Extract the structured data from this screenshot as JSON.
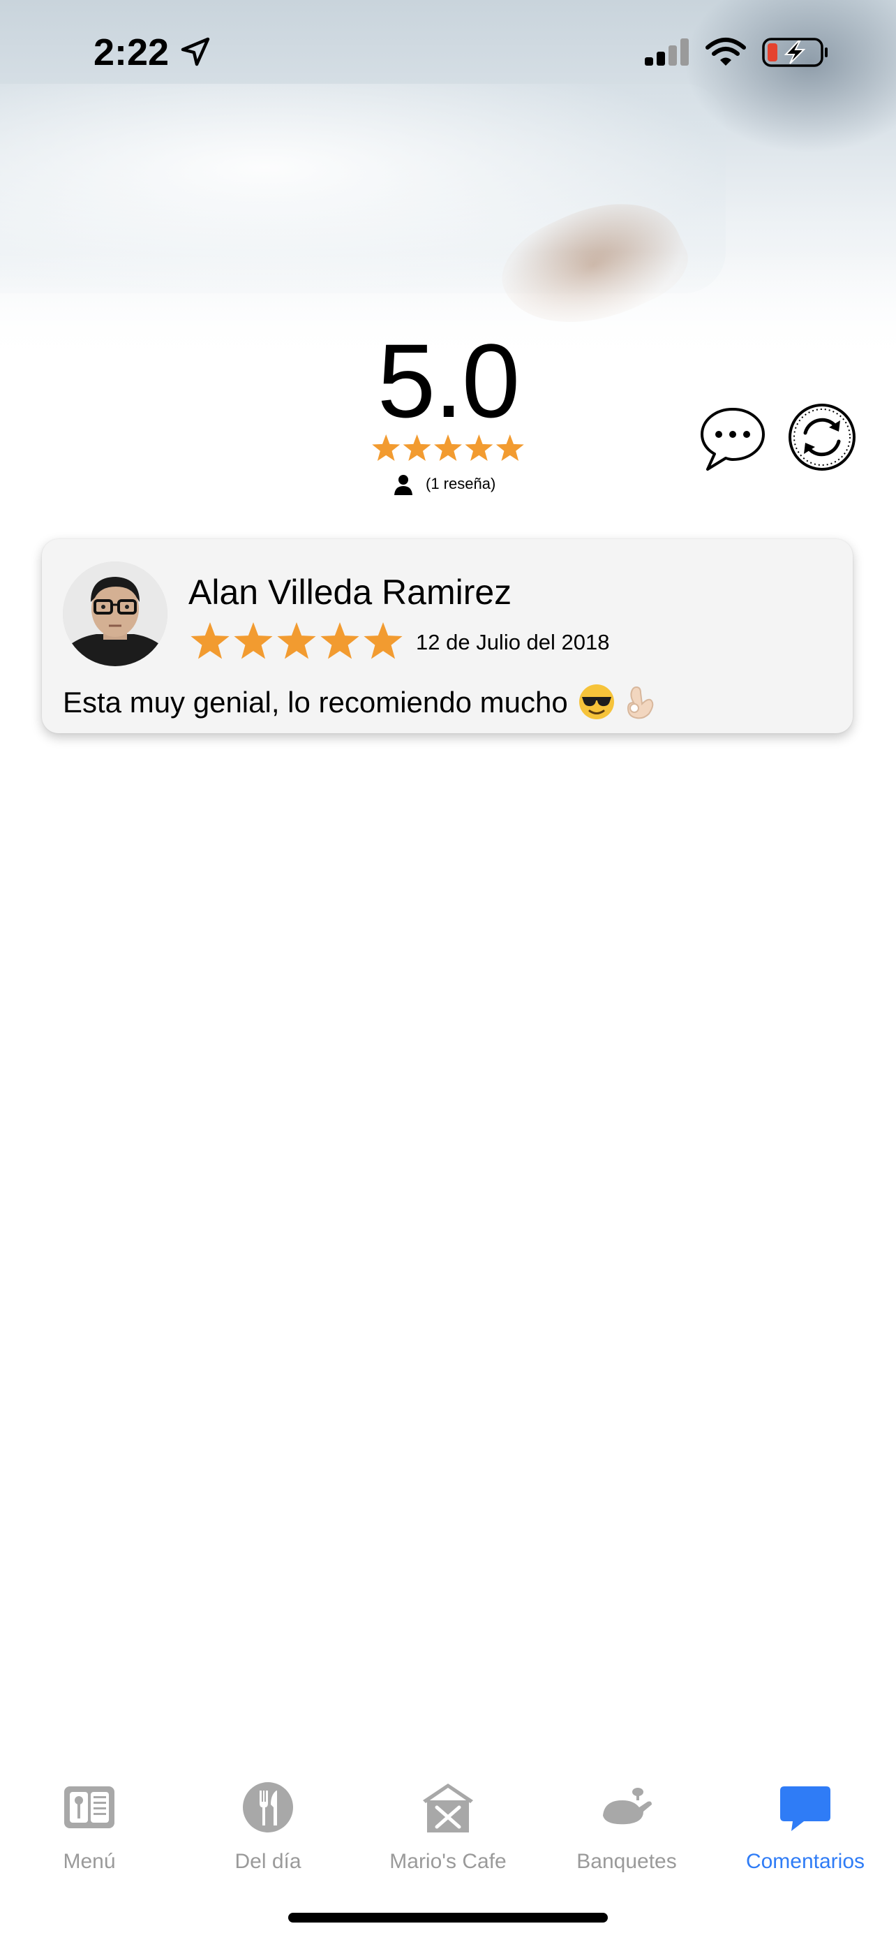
{
  "status_bar": {
    "time": "2:22",
    "icons": [
      "location-arrow-icon",
      "cellular-signal-icon",
      "wifi-icon",
      "battery-charging-icon"
    ]
  },
  "rating_summary": {
    "score": "5.0",
    "stars_filled": 5,
    "stars_total": 5,
    "review_count_text": "(1 reseña)",
    "star_color": "#f29b30"
  },
  "actions": {
    "comment_icon": "chat-bubble-dots-icon",
    "refresh_icon": "refresh-icon"
  },
  "reviews": [
    {
      "name": "Alan Villeda Ramirez",
      "stars_filled": 5,
      "date": "12 de Julio del 2018",
      "comment": "Esta muy genial, lo recomiendo mucho",
      "emojis": [
        "sunglasses-face-emoji",
        "ok-hand-emoji"
      ]
    }
  ],
  "tab_bar": {
    "active_color": "#2f7cf6",
    "inactive_color": "#9a9a9a",
    "tabs": [
      {
        "label": "Menú",
        "icon": "menu-book-icon",
        "active": false
      },
      {
        "label": "Del día",
        "icon": "fork-knife-icon",
        "active": false
      },
      {
        "label": "Mario's Cafe",
        "icon": "restaurant-house-icon",
        "active": false
      },
      {
        "label": "Banquetes",
        "icon": "serving-dish-icon",
        "active": false
      },
      {
        "label": "Comentarios",
        "icon": "chat-bubble-icon",
        "active": true
      }
    ]
  }
}
